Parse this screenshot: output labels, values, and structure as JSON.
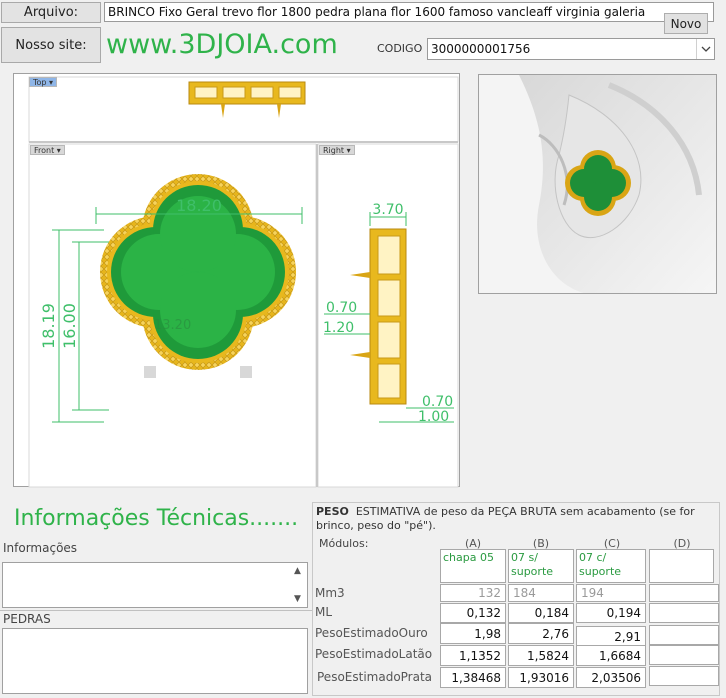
{
  "header": {
    "arquivo_label": "Arquivo:",
    "arquivo_value": "BRINCO Fixo Geral trevo flor 1800 pedra plana flor 1600 famoso vancleaff virginia galeria",
    "novo_label": "Novo",
    "site_label": "Nosso site:",
    "site_url": "www.3DJOIA.com",
    "codigo_label": "CODIGO",
    "codigo_value": "3000000001756"
  },
  "views": {
    "top": "Top",
    "front": "Front",
    "right": "Right",
    "front_dims": {
      "width": "18.20",
      "height_outer": "18.19",
      "height_inner": "16.00",
      "center": "13.20"
    },
    "right_dims": {
      "depth": "3.70",
      "pin1": "0.70",
      "pin2": "1.20",
      "base1": "0.70",
      "base2": "1.00"
    }
  },
  "info": {
    "title": "Informações Técnicas.......",
    "informacoes_label": "Informações",
    "pedras_label": "PEDRAS"
  },
  "peso": {
    "title": "PESO",
    "description": "ESTIMATIVA de peso da PEÇA BRUTA sem acabamento (se for brinco, peso do \"pé\").",
    "modulos_label": "Módulos:",
    "columns": [
      {
        "letter": "(A)",
        "header": "chapa 05"
      },
      {
        "letter": "(B)",
        "header": "07 s/ suporte"
      },
      {
        "letter": "(C)",
        "header": "07 c/ suporte"
      },
      {
        "letter": "(D)",
        "header": ""
      }
    ],
    "rows": [
      {
        "label": "Mm3",
        "values": [
          "132",
          "184",
          "194",
          ""
        ]
      },
      {
        "label": "ML",
        "values": [
          "0,132",
          "0,184",
          "0,194",
          ""
        ]
      },
      {
        "label": "PesoEstimadoOuro",
        "values": [
          "1,98",
          "2,76",
          "2,91",
          ""
        ]
      },
      {
        "label": "PesoEstimadoLatão",
        "values": [
          "1,1352",
          "1,5824",
          "1,6684",
          ""
        ]
      },
      {
        "label": "PesoEstimadoPrata",
        "values": [
          "1,38468",
          "1,93016",
          "2,03506",
          ""
        ]
      }
    ]
  },
  "colors": {
    "accent_green": "#2fb34a",
    "gold": "#e8b81e",
    "enamel": "#1f9a3a"
  },
  "icons": {
    "dropdown": "chevron-down-icon",
    "scroll_up": "scroll-up-icon",
    "scroll_down": "scroll-down-icon"
  }
}
